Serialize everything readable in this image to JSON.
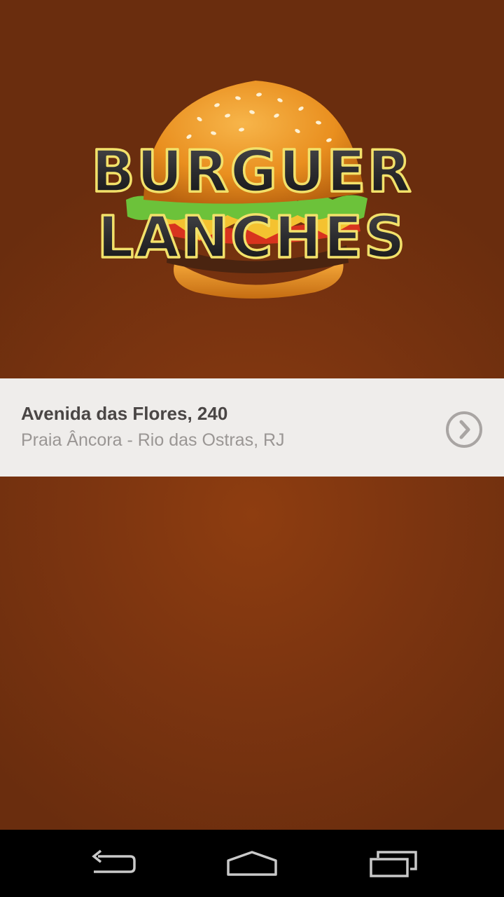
{
  "logo": {
    "line1": "BURGUER",
    "line2": "LANCHES"
  },
  "location": {
    "address": "Avenida das Flores, 240",
    "district": "Praia Âncora - Rio das Ostras, RJ",
    "chevron_icon": "chevron-right-circle-icon"
  },
  "navbar": {
    "back_icon": "back-icon",
    "home_icon": "home-icon",
    "recents_icon": "recent-apps-icon"
  },
  "colors": {
    "background": "#7d3510",
    "card": "#efedeb",
    "address_text": "#4a4645",
    "district_text": "#9a9694",
    "navbar": "#000000"
  }
}
